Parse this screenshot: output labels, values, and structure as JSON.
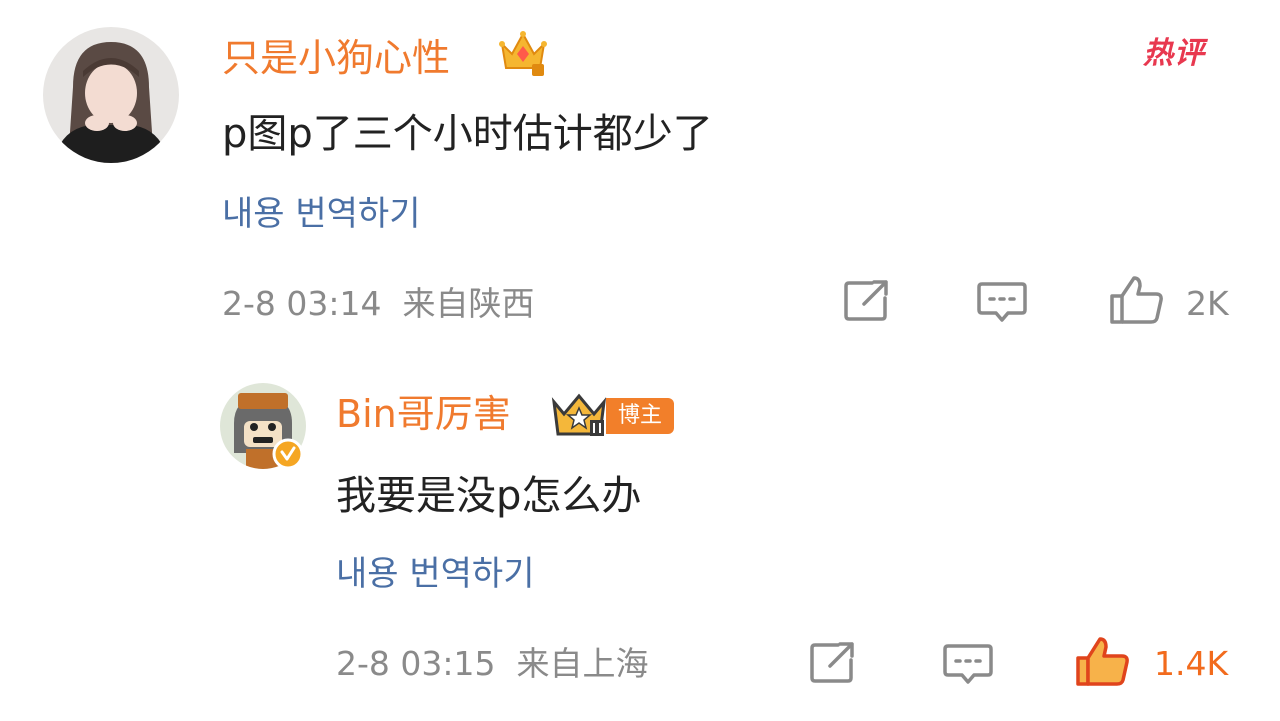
{
  "hot_badge": "热评",
  "comment": {
    "username": "只是小狗心性",
    "text": "p图p了三个小时估计都少了",
    "translate_label": "내용 번역하기",
    "timestamp": "2-8 03:14",
    "location": "来自陕西",
    "like_count": "2K",
    "liked": false
  },
  "reply": {
    "username": "Bin哥厉害",
    "badge_label": "博主",
    "text": "我要是没p怎么办",
    "translate_label": "내용 번역하기",
    "timestamp": "2-8 03:15",
    "location": "来自上海",
    "like_count": "1.4K",
    "liked": true
  },
  "colors": {
    "username": "#f07a2e",
    "link": "#4a6fa5",
    "meta": "#8a8a8a",
    "liked": "#f26b1d",
    "hot": "#e8384f"
  },
  "icons": [
    "crown-vip-icon",
    "crown-level-2-icon",
    "verified-badge-icon",
    "share-icon",
    "comment-icon",
    "like-icon",
    "like-filled-icon"
  ]
}
